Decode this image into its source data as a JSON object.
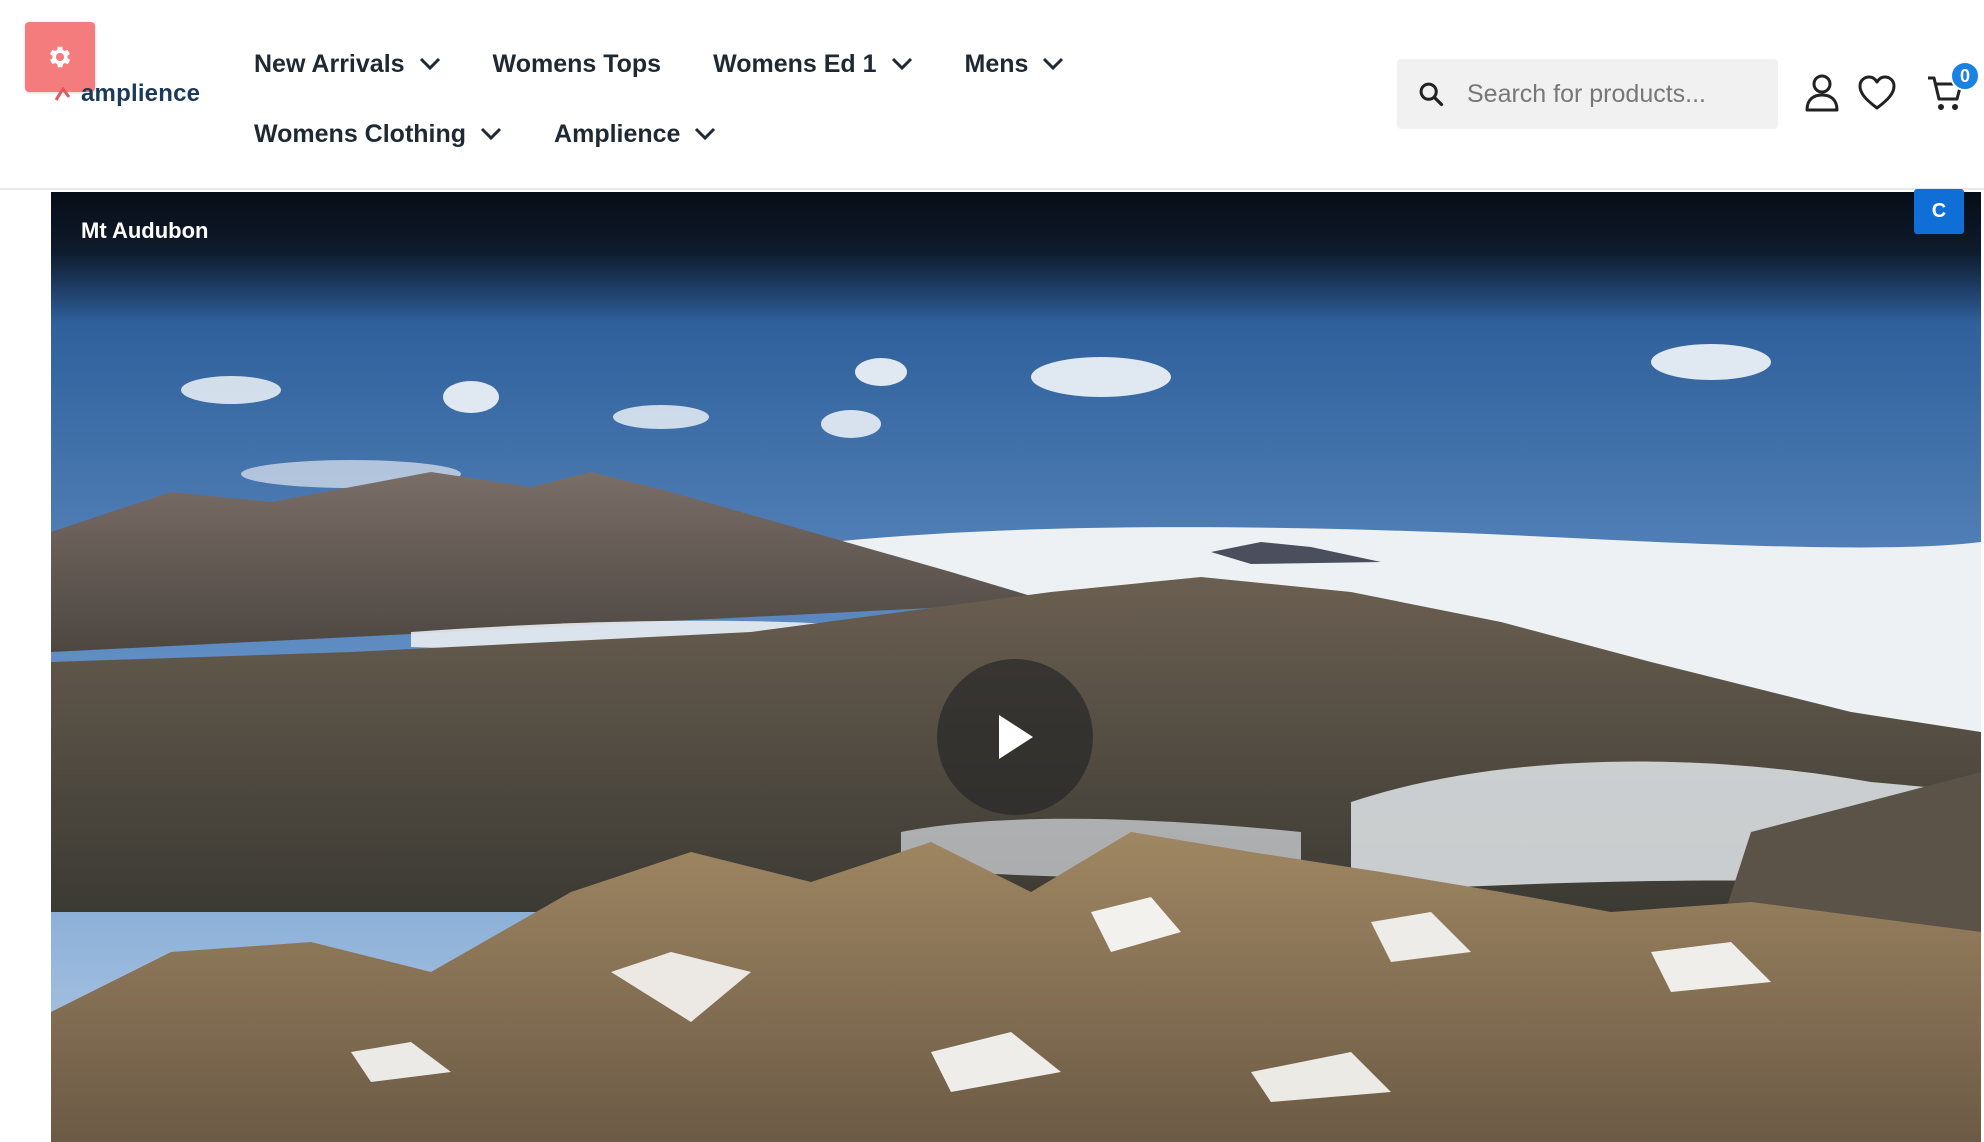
{
  "brand": {
    "logo_text": "amplience",
    "logo_color": "#1b3a5b"
  },
  "settings": {
    "icon": "gear-icon",
    "color": "#f47c7c"
  },
  "nav": {
    "row1": [
      {
        "label": "New Arrivals",
        "dropdown": true
      },
      {
        "label": "Womens Tops",
        "dropdown": false
      },
      {
        "label": "Womens Ed 1",
        "dropdown": true
      },
      {
        "label": "Mens",
        "dropdown": true
      }
    ],
    "row2": [
      {
        "label": "Womens Clothing",
        "dropdown": true
      },
      {
        "label": "Amplience",
        "dropdown": true
      }
    ]
  },
  "search": {
    "placeholder": "Search for products...",
    "icon": "search-icon"
  },
  "header_icons": {
    "account": "user-icon",
    "wishlist": "heart-icon",
    "cart": "cart-icon"
  },
  "cart": {
    "count": "0",
    "badge_color": "#1a82e2"
  },
  "video": {
    "title": "Mt Audubon",
    "play_icon": "play-icon"
  },
  "overlay_badge": {
    "label": "C",
    "color": "#0f6fd6"
  }
}
